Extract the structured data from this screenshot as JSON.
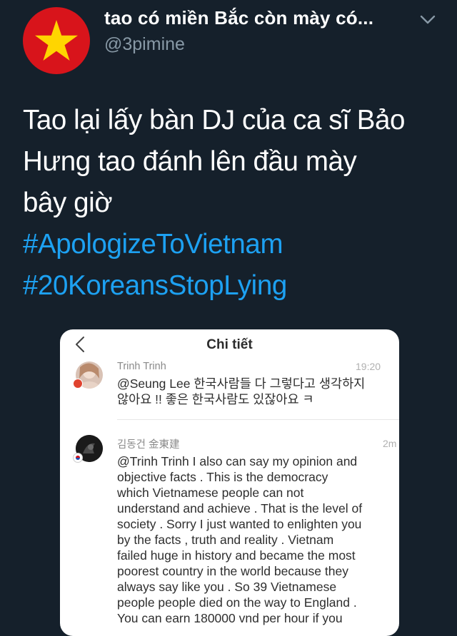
{
  "tweet": {
    "display_name": "tao có miền Bắc còn mày có...",
    "handle": "@3pimine",
    "text_lines": [
      "Tao lại lấy bàn DJ của ca sĩ Bảo",
      "Hưng tao đánh lên đầu mày",
      "bây giờ"
    ],
    "hashtags": [
      "#ApologizeToVietnam",
      "#20KoreansStopLying"
    ]
  },
  "screenshot": {
    "title": "Chi tiết",
    "comments": [
      {
        "author": "Trinh Trinh",
        "time": "19:20",
        "lines": [
          "@Seung Lee  한국사람들 다 그렇다고 생각하지",
          "않아요 !! 좋은 한국사람도 있잖아요 ㅋ"
        ]
      },
      {
        "author": "김동건 金東建",
        "time": "2m",
        "lines": [
          "@Trinh Trinh I also can say my opinion and",
          "objective facts . This is the democracy",
          "which Vietnamese people can not",
          "understand and achieve . That is the level of",
          "society . Sorry I just wanted to enlighten you",
          "by the facts , truth and reality . Vietnam",
          "failed huge in history and became the most",
          "poorest country in the world because they",
          "always say like you . So 39 Vietnamese",
          "people people died on the way to England .",
          "You can earn 180000 vnd per hour if you"
        ]
      }
    ]
  },
  "icons": {
    "avatar": "vietnam-flag-star",
    "menu": "chevron-down-icon",
    "back": "back-arrow-icon"
  },
  "colors": {
    "background": "#15202b",
    "hashtag": "#1da1f2",
    "secondary_text": "#8899a6",
    "flag_red": "#d8141b",
    "flag_star": "#ffd500"
  }
}
